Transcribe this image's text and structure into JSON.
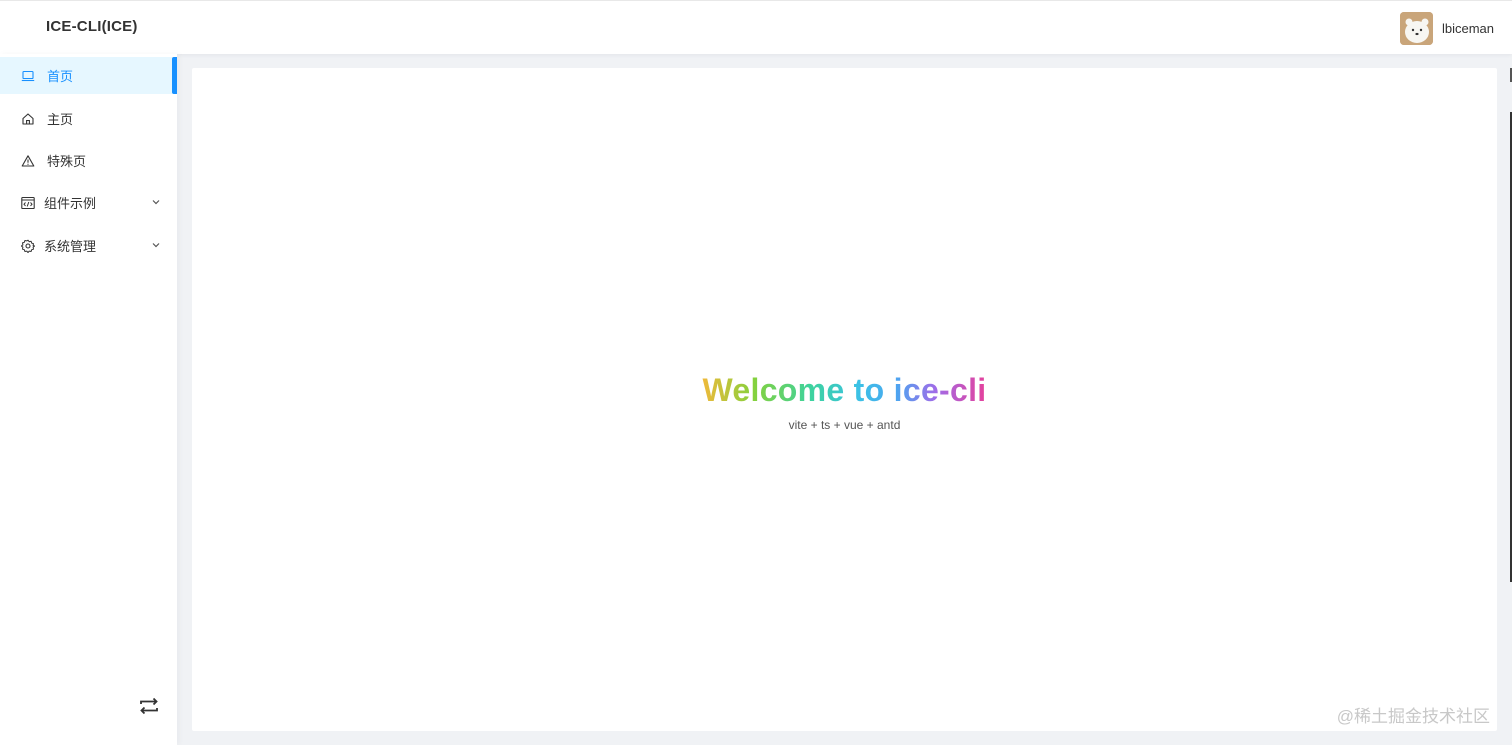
{
  "header": {
    "app_title": "ICE-CLI(ICE)",
    "username": "lbiceman"
  },
  "sidebar": {
    "items": [
      {
        "label": "首页",
        "icon": "laptop-icon",
        "active": true
      },
      {
        "label": "主页",
        "icon": "home-icon",
        "active": false
      },
      {
        "label": "特殊页",
        "icon": "warning-icon",
        "active": false
      },
      {
        "label": "组件示例",
        "icon": "code-icon",
        "active": false,
        "expandable": true
      },
      {
        "label": "系统管理",
        "icon": "gear-icon",
        "active": false,
        "expandable": true
      }
    ],
    "collapse_icon": "swap-icon"
  },
  "main": {
    "welcome_title": "Welcome to ice-cli",
    "welcome_subtitle": "vite + ts + vue + antd"
  },
  "watermark": "@稀土掘金技术社区",
  "colors": {
    "accent": "#1890ff",
    "active_bg": "#e6f7ff",
    "page_bg": "#f0f2f5"
  }
}
